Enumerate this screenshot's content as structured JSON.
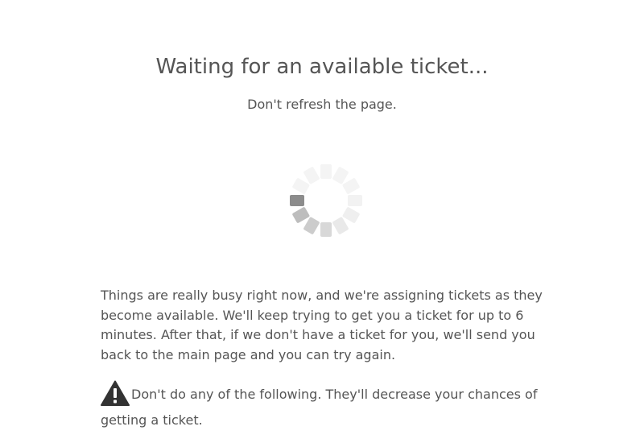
{
  "header": {
    "title": "Waiting for an available ticket...",
    "subtitle": "Don't refresh the page."
  },
  "spinner": {
    "icon": "loading-spinner-icon"
  },
  "body": {
    "description": "Things are really busy right now, and we're assigning tickets as they become available. We'll keep trying to get you a ticket for up to 6 minutes. After that, if we don't have a ticket for you, we'll send you back to the main page and you can try again.",
    "warning_icon": "warning-triangle-icon",
    "warning_text": "Don't do any of the following. They'll decrease your chances of getting a ticket."
  }
}
